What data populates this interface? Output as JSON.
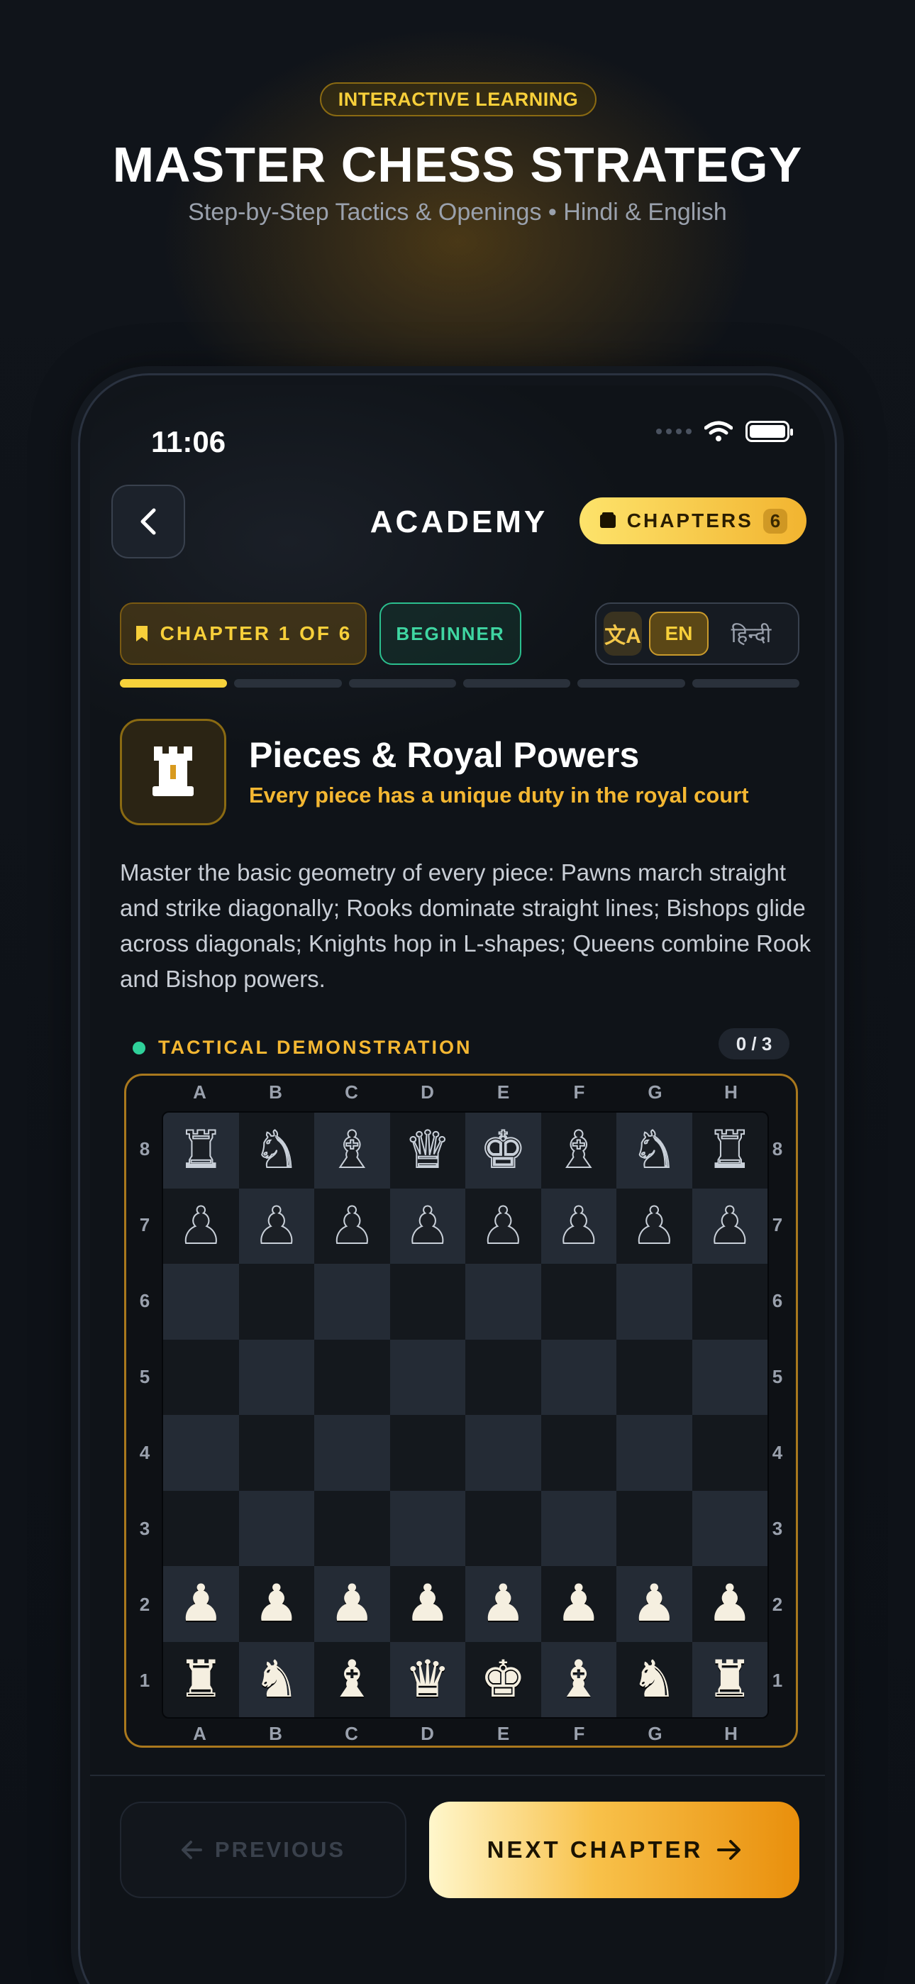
{
  "hero": {
    "badge": "INTERACTIVE LEARNING",
    "title": "MASTER CHESS STRATEGY",
    "subtitle": "Step-by-Step Tactics & Openings • Hindi & English"
  },
  "status_bar": {
    "time": "11:06"
  },
  "nav": {
    "title": "ACADEMY",
    "chapters_label": "CHAPTERS",
    "chapters_count": "6"
  },
  "lesson_meta": {
    "chapter_label": "CHAPTER 1 OF 6",
    "level": "BEGINNER",
    "lang_icon": "文A",
    "lang_en": "EN",
    "lang_hi": "हिन्दी",
    "progress_segments": 6,
    "progress_active": 1
  },
  "lesson": {
    "icon": "rook-icon",
    "title": "Pieces & Royal Powers",
    "subtitle": "Every piece has a unique duty in the royal court",
    "body": "Master the basic geometry of every piece: Pawns march straight and strike diagonally; Rooks dominate straight lines; Bishops glide across diagonals; Knights hop in L-shapes; Queens combine Rook and Bishop powers."
  },
  "demo": {
    "label": "TACTICAL DEMONSTRATION",
    "counter": "0 / 3"
  },
  "board": {
    "files": [
      "A",
      "B",
      "C",
      "D",
      "E",
      "F",
      "G",
      "H"
    ],
    "ranks": [
      "8",
      "7",
      "6",
      "5",
      "4",
      "3",
      "2",
      "1"
    ],
    "rows": [
      [
        "r",
        "n",
        "b",
        "q",
        "k",
        "b",
        "n",
        "r"
      ],
      [
        "p",
        "p",
        "p",
        "p",
        "p",
        "p",
        "p",
        "p"
      ],
      [
        "",
        "",
        "",
        "",
        "",
        "",
        "",
        ""
      ],
      [
        "",
        "",
        "",
        "",
        "",
        "",
        "",
        ""
      ],
      [
        "",
        "",
        "",
        "",
        "",
        "",
        "",
        ""
      ],
      [
        "",
        "",
        "",
        "",
        "",
        "",
        "",
        ""
      ],
      [
        "P",
        "P",
        "P",
        "P",
        "P",
        "P",
        "P",
        "P"
      ],
      [
        "R",
        "N",
        "B",
        "Q",
        "K",
        "B",
        "N",
        "R"
      ]
    ]
  },
  "footer": {
    "prev_label": "PREVIOUS",
    "next_label": "NEXT CHAPTER"
  },
  "colors": {
    "accent_gold": "#f7cf3a",
    "accent_green": "#2fd19a",
    "background": "#0d1117"
  }
}
